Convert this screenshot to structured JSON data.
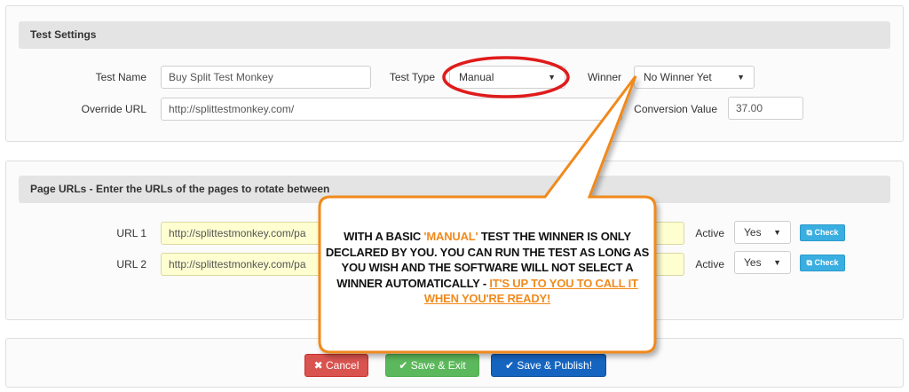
{
  "settings": {
    "header": "Test Settings",
    "test_name_label": "Test Name",
    "test_name_value": "Buy Split Test Monkey",
    "test_type_label": "Test Type",
    "test_type_value": "Manual",
    "winner_label": "Winner",
    "winner_value": "No Winner Yet",
    "override_url_label": "Override URL",
    "override_url_value": "http://splittestmonkey.com/",
    "conversion_value_label": "Conversion Value",
    "conversion_value": "37.00"
  },
  "pages": {
    "header": "Page URLs - Enter the URLs of the pages to rotate between",
    "rows": [
      {
        "label": "URL 1",
        "url": "http://splittestmonkey.com/pa",
        "active_label": "Active",
        "active_value": "Yes",
        "check_label": "Check"
      },
      {
        "label": "URL 2",
        "url": "http://splittestmonkey.com/pa",
        "active_label": "Active",
        "active_value": "Yes",
        "check_label": "Check"
      }
    ]
  },
  "footer": {
    "cancel_label": "Cancel",
    "save_exit_label": "Save & Exit",
    "save_publish_label": "Save & Publish!"
  },
  "callout": {
    "part1": "WITH A BASIC ",
    "highlight": "'MANUAL'",
    "part2": " TEST THE WINNER IS ONLY DECLARED BY YOU.  YOU CAN RUN THE TEST AS LONG AS YOU WISH AND THE SOFTWARE WILL NOT SELECT A WINNER AUTOMATICALLY - ",
    "underline": "IT'S UP TO YOU TO CALL IT WHEN YOU'RE READY!"
  },
  "colors": {
    "callout_border": "#f08a1c",
    "highlight_ring": "#e01b1b",
    "check_button": "#3aaee0",
    "cancel_button": "#d9534f",
    "save_exit_button": "#5cb85c",
    "save_publish_button": "#1565c0"
  },
  "icons": {
    "cancel": "close-icon",
    "save_exit": "checkmark-icon",
    "save_publish": "checkmark-icon",
    "check": "external-link-icon"
  }
}
